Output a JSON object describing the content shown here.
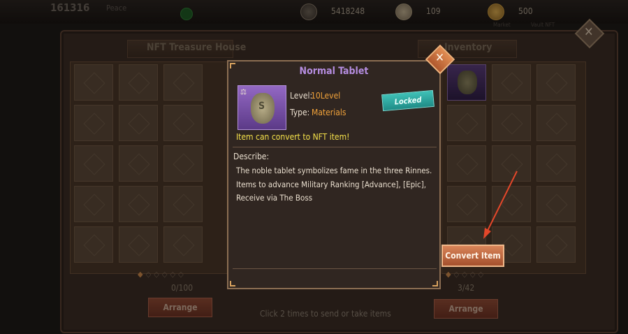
{
  "hud": {
    "player_id": "161316",
    "player_name": "Peace",
    "currencies": [
      {
        "icon": "coin-dark-icon",
        "value": "5418248"
      },
      {
        "icon": "coin-pale-icon",
        "value": "109"
      },
      {
        "icon": "coin-gold-icon",
        "value": "500"
      }
    ],
    "market_label": "Market",
    "nft_label": "Vault NFT"
  },
  "treasure": {
    "title": "NFT Treasure House",
    "count": "0/100",
    "arrange_label": "Arrange"
  },
  "inventory": {
    "title": "Inventory",
    "count": "3/42",
    "arrange_label": "Arrange"
  },
  "hint": "Click 2 times to send or take items",
  "popup": {
    "title": "Normal Tablet",
    "level_label": "Level:",
    "level_value": "10Level",
    "type_label": "Type:",
    "type_value": "Materials",
    "status": "Locked",
    "convert_note": "Item can convert to NFT item!",
    "describe_label": "Describe:",
    "description": [
      "The noble tablet symbolizes fame in the three Rinnes.",
      "Items to advance Military Ranking [Advance], [Epic],",
      "Receive via The Boss"
    ],
    "item_icon": "tablet-bag-icon"
  },
  "convert_button": "Convert Item",
  "colors": {
    "rarity_purple": "#7b52ad",
    "accent_orange": "#f1a23a",
    "locked_teal": "#2aa69e",
    "note_yellow": "#f4e04a",
    "arrow_red": "#e4472a"
  }
}
